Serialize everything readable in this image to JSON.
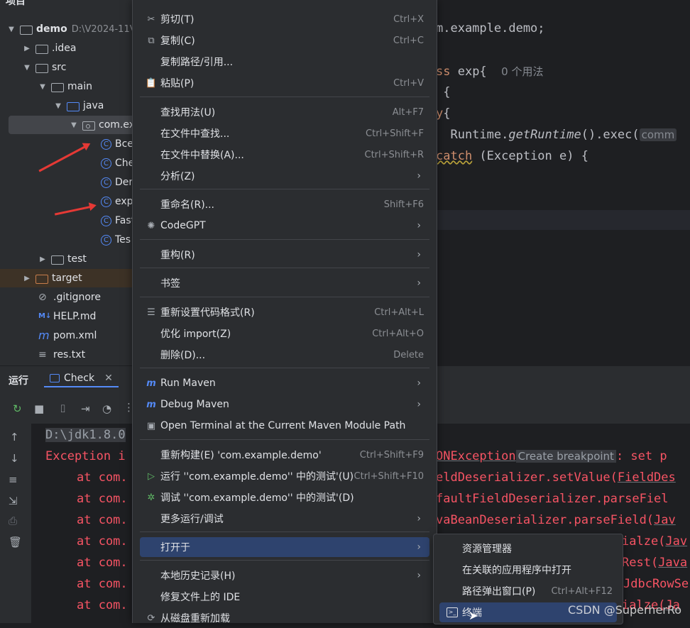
{
  "project": {
    "title": "项目",
    "root": {
      "name": "demo",
      "path": "D:\\V2024-11V"
    },
    "items": [
      {
        "label": ".idea"
      },
      {
        "label": "src"
      },
      {
        "label": "main"
      },
      {
        "label": "java"
      },
      {
        "label": "com.ex"
      },
      {
        "label": "Bce"
      },
      {
        "label": "Che"
      },
      {
        "label": "Der"
      },
      {
        "label": "exp"
      },
      {
        "label": "Fast"
      },
      {
        "label": "Tes"
      },
      {
        "label": "test"
      },
      {
        "label": "target"
      },
      {
        "label": ".gitignore"
      },
      {
        "label": "HELP.md"
      },
      {
        "label": "pom.xml"
      },
      {
        "label": "res.txt"
      }
    ]
  },
  "editor": {
    "line1": "m.example.demo;",
    "line2_kw": "ss",
    "line2_rest": " exp{",
    "line2_hint": "0 个用法",
    "line3": " {",
    "line4_kw": "y",
    "line4_rest": "{",
    "line5_a": "  Runtime.",
    "line5_b": "getRuntime",
    "line5_c": "().exec(",
    "line5_chip": "comm",
    "line6_kw": "catch",
    "line6_rest": " (Exception e) {"
  },
  "run": {
    "title": "运行",
    "tab": "Check",
    "console": {
      "path": "D:\\jdk1.8.0",
      "exc": "Exception i",
      "at_prefix": "at com.",
      "r1_a": "ONException",
      "r1_b": "Create breakpoint",
      "r1_c": ": set p",
      "r2_a": "eldDeserializer.setValue(",
      "r2_b": "FieldDes",
      "r3": "faultFieldDeserializer.parseFiel",
      "r4_a": "vaBeanDeserializer.parseField(",
      "r4_b": "Jav",
      "r5_a": "ialze(",
      "r5_b": "Jav",
      "r6_a": "Rest(",
      "r6_b": "Java",
      "r7": "JdbcRowSe",
      "r8_a": "ialze(",
      "r8_b": "Ja"
    }
  },
  "menu": {
    "items": [
      {
        "label": "剪切(T)",
        "shortcut": "Ctrl+X"
      },
      {
        "label": "复制(C)",
        "shortcut": "Ctrl+C"
      },
      {
        "label": "复制路径/引用...",
        "shortcut": ""
      },
      {
        "label": "粘贴(P)",
        "shortcut": "Ctrl+V"
      },
      {
        "label": "查找用法(U)",
        "shortcut": "Alt+F7"
      },
      {
        "label": "在文件中查找...",
        "shortcut": "Ctrl+Shift+F"
      },
      {
        "label": "在文件中替换(A)...",
        "shortcut": "Ctrl+Shift+R"
      },
      {
        "label": "分析(Z)",
        "shortcut": ""
      },
      {
        "label": "重命名(R)...",
        "shortcut": "Shift+F6"
      },
      {
        "label": "CodeGPT",
        "shortcut": ""
      },
      {
        "label": "重构(R)",
        "shortcut": ""
      },
      {
        "label": "书签",
        "shortcut": ""
      },
      {
        "label": "重新设置代码格式(R)",
        "shortcut": "Ctrl+Alt+L"
      },
      {
        "label": "优化 import(Z)",
        "shortcut": "Ctrl+Alt+O"
      },
      {
        "label": "删除(D)...",
        "shortcut": "Delete"
      },
      {
        "label": "Run Maven",
        "shortcut": ""
      },
      {
        "label": "Debug Maven",
        "shortcut": ""
      },
      {
        "label": "Open Terminal at the Current Maven Module Path",
        "shortcut": ""
      },
      {
        "label": "重新构建(E) 'com.example.demo'",
        "shortcut": "Ctrl+Shift+F9"
      },
      {
        "label": "运行 ''com.example.demo'' 中的测试'(U)",
        "shortcut": "Ctrl+Shift+F10"
      },
      {
        "label": "调试 ''com.example.demo'' 中的测试'(D)",
        "shortcut": ""
      },
      {
        "label": "更多运行/调试",
        "shortcut": ""
      },
      {
        "label": "打开于",
        "shortcut": ""
      },
      {
        "label": "本地历史记录(H)",
        "shortcut": ""
      },
      {
        "label": "修复文件上的 IDE",
        "shortcut": ""
      },
      {
        "label": "从磁盘重新加载",
        "shortcut": ""
      }
    ]
  },
  "submenu": {
    "items": [
      {
        "label": "资源管理器",
        "shortcut": ""
      },
      {
        "label": "在关联的应用程序中打开",
        "shortcut": ""
      },
      {
        "label": "路径弹出窗口(P)",
        "shortcut": "Ctrl+Alt+F12"
      },
      {
        "label": "终端",
        "shortcut": ""
      }
    ]
  },
  "watermark": "CSDN @SuperherRo"
}
